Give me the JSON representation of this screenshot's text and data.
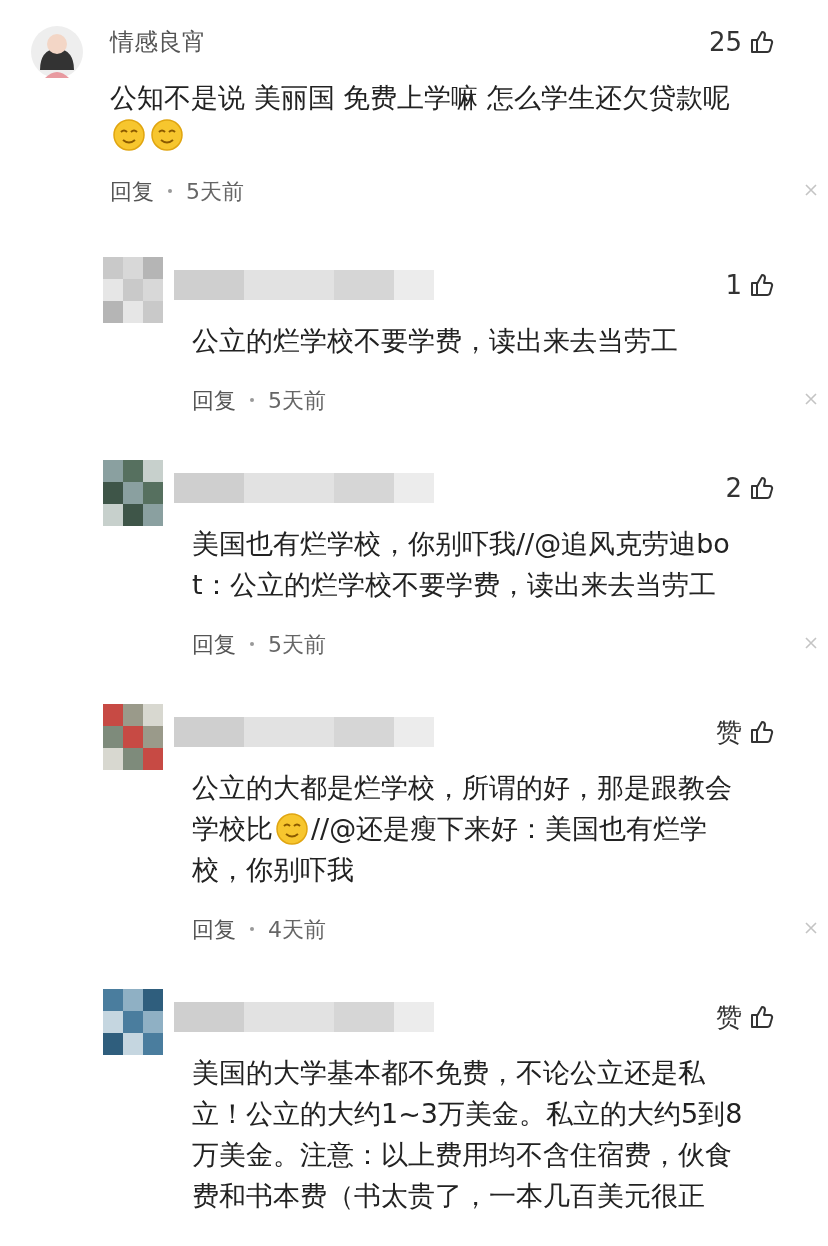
{
  "comments": [
    {
      "author": "情感良宵",
      "author_blurred": false,
      "likes": "25",
      "lines": [
        [
          {
            "kind": "text",
            "text": "公知不是说 美丽国 免费上学嘛 怎么学生还欠贷款呢"
          }
        ],
        [
          {
            "kind": "emoji"
          },
          {
            "kind": "emoji"
          }
        ]
      ],
      "reply_label": "回复",
      "time": "5天前",
      "replies": [
        {
          "author_blurred": true,
          "likes": "1",
          "lines": [
            [
              {
                "kind": "text",
                "text": "公立的烂学校不要学费，读出来去当劳工"
              }
            ]
          ],
          "reply_label": "回复",
          "time": "5天前"
        },
        {
          "author_blurred": true,
          "likes": "2",
          "lines": [
            [
              {
                "kind": "text",
                "text": "美国也有烂学校，你别吓我//@追风克劳迪bo"
              }
            ],
            [
              {
                "kind": "text",
                "text": "t：公立的烂学校不要学费，读出来去当劳工"
              }
            ]
          ],
          "reply_label": "回复",
          "time": "5天前"
        },
        {
          "author_blurred": true,
          "likes": "赞",
          "lines": [
            [
              {
                "kind": "text",
                "text": "公立的大都是烂学校，所谓的好，那是跟教会"
              }
            ],
            [
              {
                "kind": "text",
                "text": "学校比"
              },
              {
                "kind": "emoji"
              },
              {
                "kind": "text",
                "text": "//@还是瘦下来好：美国也有烂学"
              }
            ],
            [
              {
                "kind": "text",
                "text": "校，你别吓我"
              }
            ]
          ],
          "reply_label": "回复",
          "time": "4天前"
        },
        {
          "author_blurred": true,
          "likes": "赞",
          "lines": [
            [
              {
                "kind": "text",
                "text": "美国的大学基本都不免费，不论公立还是私"
              }
            ],
            [
              {
                "kind": "text",
                "text": "立！公立的大约1~3万美金。私立的大约5到8"
              }
            ],
            [
              {
                "kind": "text",
                "text": "万美金。注意：以上费用均不含住宿费，伙食"
              }
            ],
            [
              {
                "kind": "text",
                "text": "费和书本费（书太贵了，一本几百美元很正"
              }
            ]
          ]
        }
      ]
    }
  ]
}
